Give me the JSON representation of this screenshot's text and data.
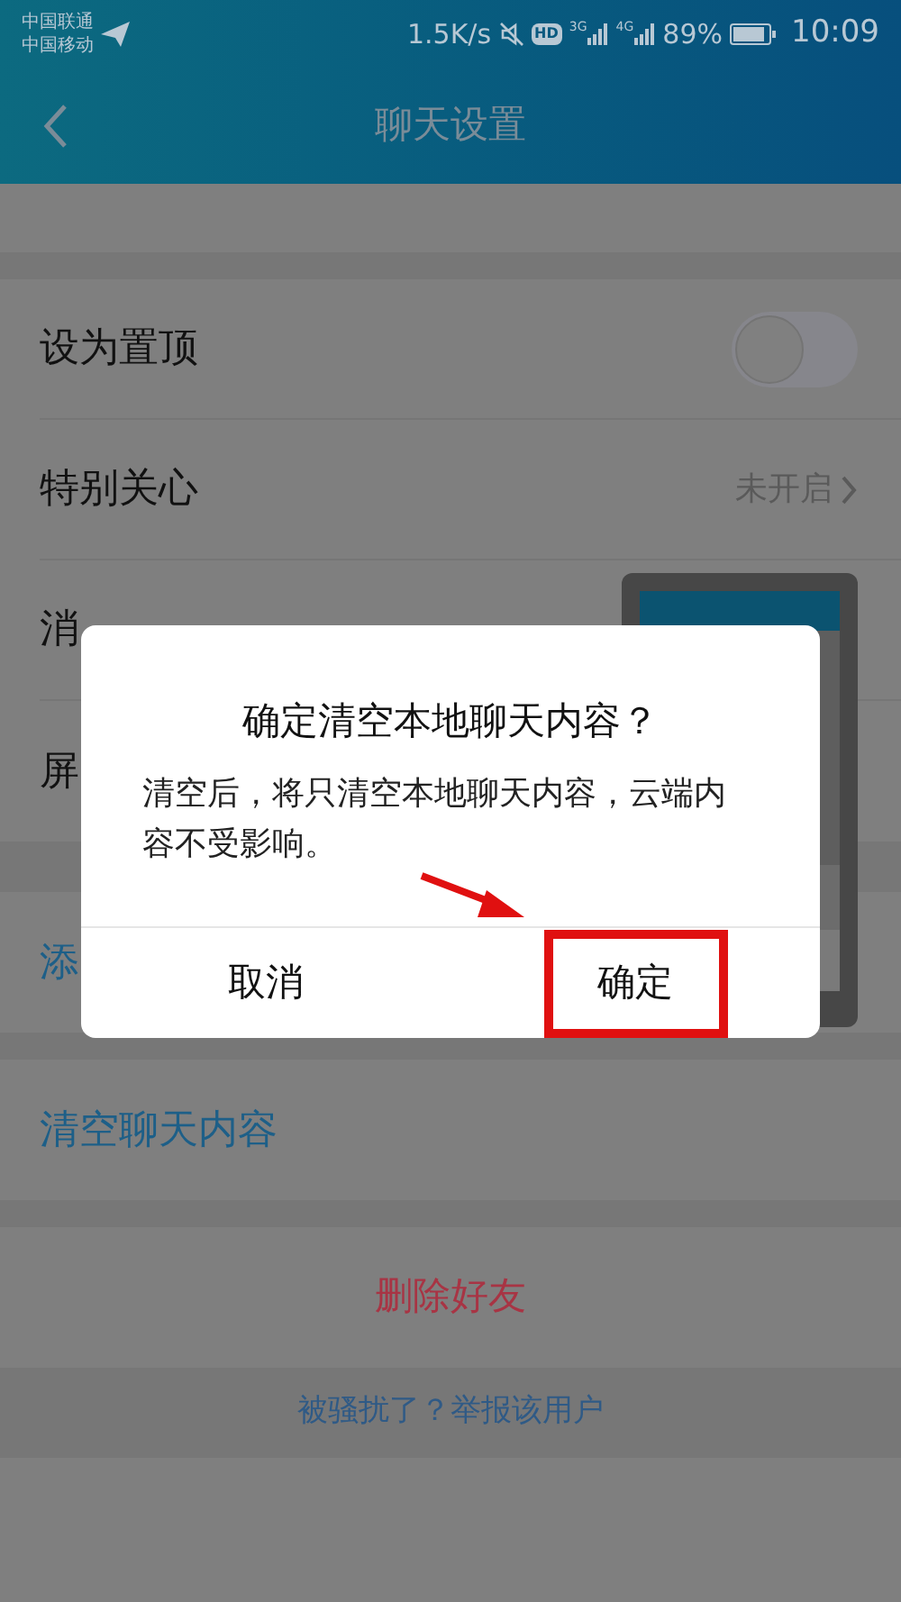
{
  "status_bar": {
    "carriers": [
      "中国联通",
      "中国移动"
    ],
    "speed": "1.5K/s",
    "hd": "HD",
    "networks": [
      "3G",
      "4G"
    ],
    "battery": "89%",
    "time": "10:09"
  },
  "header": {
    "title": "聊天设置"
  },
  "sections": [
    {
      "rows": [
        {
          "kind": "toggle",
          "label": "设为置顶",
          "on": false
        },
        {
          "kind": "link",
          "label": "特别关心",
          "value": "未开启"
        },
        {
          "kind": "plain",
          "label": "消"
        },
        {
          "kind": "plain",
          "label": "屏"
        }
      ]
    },
    {
      "rows": [
        {
          "kind": "action",
          "label": "添"
        }
      ]
    },
    {
      "rows": [
        {
          "kind": "action",
          "label": "清空聊天内容"
        }
      ]
    }
  ],
  "delete_button": "删除好友",
  "report_link": "被骚扰了？举报该用户",
  "dialog": {
    "title": "确定清空本地聊天内容？",
    "message": "清空后，将只清空本地聊天内容，云端内容不受影响。",
    "buttons": [
      {
        "label": "取消",
        "annotated": false
      },
      {
        "label": "确定",
        "annotated": true
      }
    ]
  }
}
